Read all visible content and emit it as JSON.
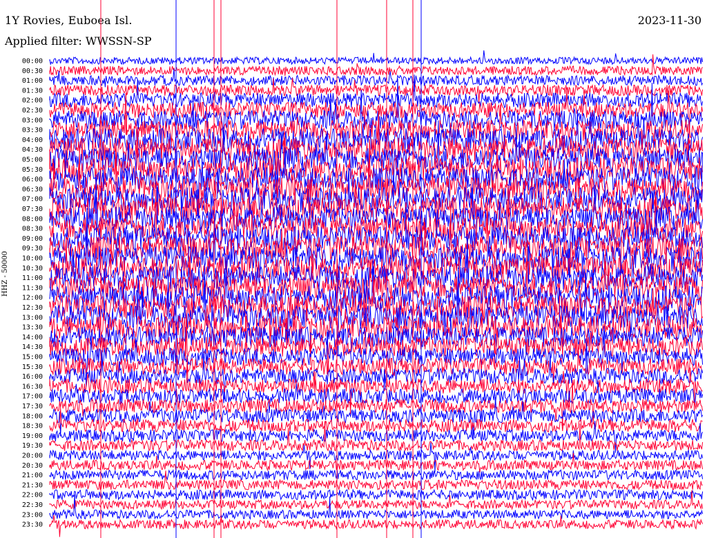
{
  "header": {
    "station": "1Y Rovies, Euboea Isl.",
    "date": "2023-11-30",
    "filter": "Applied filter: WWSSN-SP"
  },
  "axis": {
    "ylabel": "HHZ - 50000"
  },
  "colors": {
    "trace_a": "#0000ff",
    "trace_b": "#ff0033"
  },
  "chart_data": {
    "type": "line",
    "title": "1Y Rovies, Euboea Isl.",
    "ylabel": "HHZ - 50000",
    "y_tick_labels": [
      "00:00",
      "00:30",
      "01:00",
      "01:30",
      "02:00",
      "02:30",
      "03:00",
      "03:30",
      "04:00",
      "04:30",
      "05:00",
      "05:30",
      "06:00",
      "06:30",
      "07:00",
      "07:30",
      "08:00",
      "08:30",
      "09:00",
      "09:30",
      "10:00",
      "10:30",
      "11:00",
      "11:30",
      "12:00",
      "12:30",
      "13:00",
      "13:30",
      "14:00",
      "14:30",
      "15:00",
      "15:30",
      "16:00",
      "16:30",
      "17:00",
      "17:30",
      "18:00",
      "18:30",
      "19:00",
      "19:30",
      "20:00",
      "20:30",
      "21:00",
      "21:30",
      "22:00",
      "22:30",
      "23:00",
      "23:30"
    ],
    "x_range_minutes": [
      0,
      30
    ],
    "series_color_pattern": [
      "#0000ff",
      "#ff0033"
    ],
    "relative_activity": [
      0.15,
      0.25,
      0.3,
      0.35,
      0.55,
      0.6,
      0.75,
      0.8,
      0.95,
      1.0,
      1.0,
      1.0,
      1.0,
      1.0,
      1.0,
      1.0,
      1.0,
      1.0,
      1.0,
      1.0,
      1.0,
      1.0,
      1.0,
      1.0,
      1.0,
      1.0,
      1.0,
      0.95,
      0.85,
      0.8,
      0.7,
      0.65,
      0.6,
      0.55,
      0.55,
      0.5,
      0.5,
      0.45,
      0.4,
      0.35,
      0.3,
      0.3,
      0.3,
      0.3,
      0.3,
      0.25,
      0.25,
      0.25
    ],
    "grid": false,
    "legend": "none"
  }
}
